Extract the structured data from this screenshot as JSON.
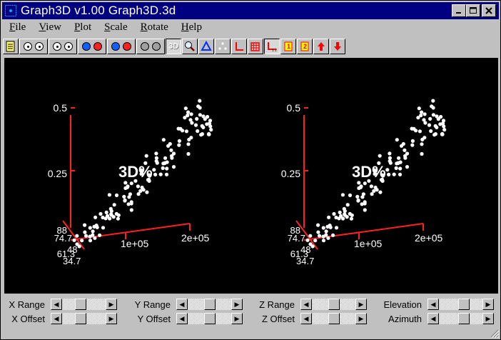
{
  "window": {
    "title": "Graph3D v1.00  Graph3D.3d"
  },
  "menu": [
    {
      "label": "File",
      "key": "F",
      "rest": "ile"
    },
    {
      "label": "View",
      "key": "V",
      "rest": "iew"
    },
    {
      "label": "Plot",
      "key": "P",
      "rest": "lot"
    },
    {
      "label": "Scale",
      "key": "S",
      "rest": "cale"
    },
    {
      "label": "Rotate",
      "key": "R",
      "rest": "otate"
    },
    {
      "label": "Help",
      "key": "H",
      "rest": "elp"
    }
  ],
  "toolbar": {
    "mode_label": "3D"
  },
  "plot": {
    "background": "#000000",
    "axis_color": "#ff2020",
    "point_color": "#ffffff",
    "watermark": "3D%",
    "z_ticks": [
      "0.5",
      "0.25"
    ],
    "x_ticks": [
      "1e+05",
      "2e+05"
    ],
    "y_ticks": [
      "88",
      "74.7",
      "61.3",
      "48",
      "34.7"
    ]
  },
  "controls": {
    "x_range": "X Range",
    "x_offset": "X Offset",
    "y_range": "Y Range",
    "y_offset": "Y Offset",
    "z_range": "Z Range",
    "z_offset": "Z Offset",
    "elevation": "Elevation",
    "azimuth": "Azimuth"
  },
  "sliders": {
    "x_range": 0.4,
    "x_offset": 0.4,
    "y_range": 0.5,
    "y_offset": 0.5,
    "z_range": 0.5,
    "z_offset": 0.5,
    "elevation": 0.6,
    "azimuth": 0.6
  }
}
